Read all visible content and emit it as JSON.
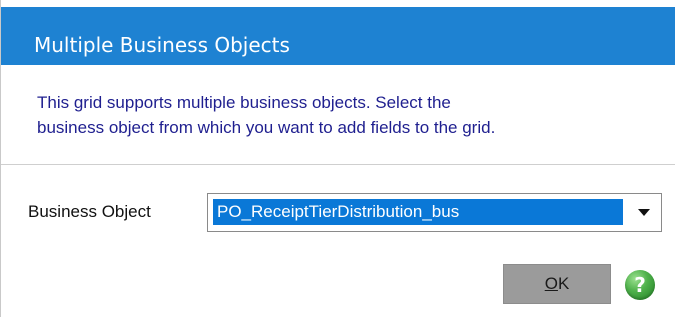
{
  "dialog": {
    "title": "Multiple Business Objects",
    "instructions_line1": "This grid supports multiple business objects.  Select the",
    "instructions_line2": "business object from which you want to add fields to the grid."
  },
  "business_object": {
    "label": "Business Object",
    "selected_value": "PO_ReceiptTierDistribution_bus"
  },
  "buttons": {
    "ok_mnemonic": "O",
    "ok_rest": "K"
  },
  "icons": {
    "help": "help-icon",
    "dropdown": "chevron-down-icon"
  },
  "colors": {
    "title_bar": "#1e82d2",
    "instruction_text": "#1f1f8f",
    "selection_highlight": "#0a78d7",
    "ok_button": "#9b9b9b",
    "help_icon": "#4fb14b"
  }
}
